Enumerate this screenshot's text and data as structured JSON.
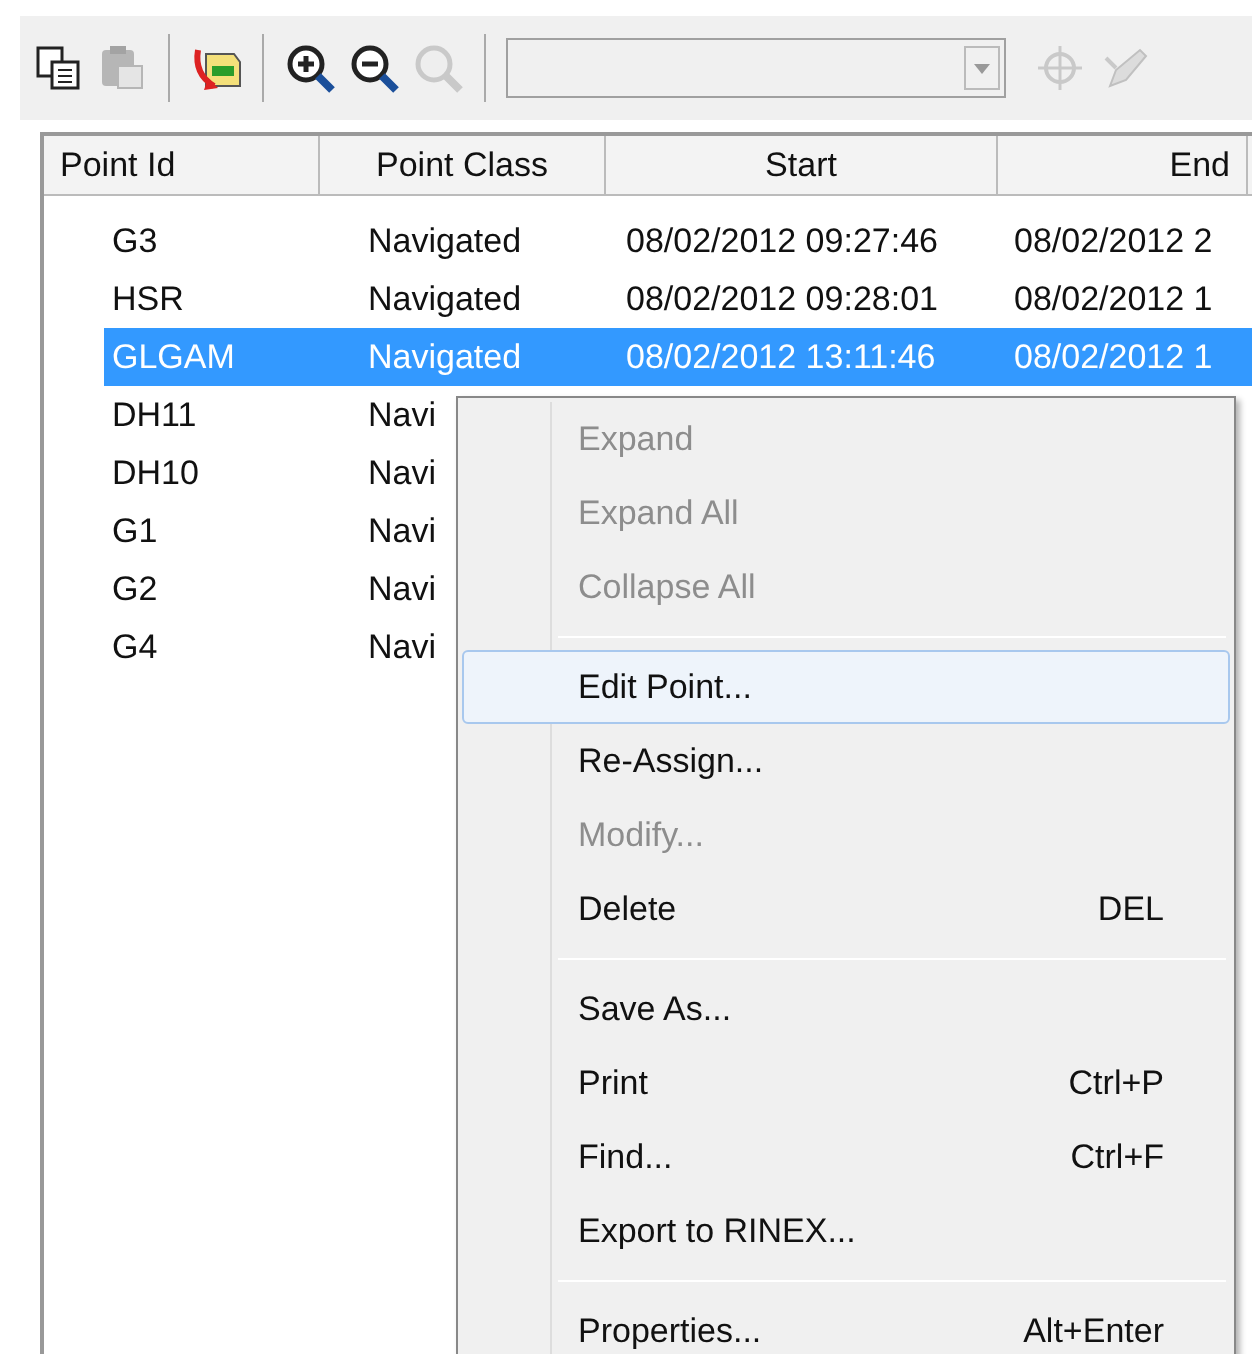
{
  "toolbar": {
    "groups": [
      [
        {
          "kind": "copy",
          "disabled": false
        },
        {
          "kind": "paste",
          "disabled": true
        }
      ],
      [
        {
          "kind": "transfer",
          "disabled": false
        }
      ],
      [
        {
          "kind": "zoom_in",
          "disabled": false
        },
        {
          "kind": "zoom_out",
          "disabled": false
        },
        {
          "kind": "zoom_reset",
          "disabled": true
        }
      ]
    ],
    "combo": {
      "disabled": true
    },
    "trailing": [
      {
        "kind": "target",
        "disabled": true
      },
      {
        "kind": "pen",
        "disabled": true
      }
    ]
  },
  "table": {
    "columns": [
      "Point Id",
      "Point Class",
      "Start",
      "End"
    ],
    "rows": [
      {
        "cells": [
          "G3",
          "Navigated",
          "08/02/2012 09:27:46",
          "08/02/2012 2"
        ],
        "selected": false
      },
      {
        "cells": [
          "HSR",
          "Navigated",
          "08/02/2012 09:28:01",
          "08/02/2012 1"
        ],
        "selected": false
      },
      {
        "cells": [
          "GLGAM",
          "Navigated",
          "08/02/2012 13:11:46",
          "08/02/2012 1"
        ],
        "selected": true
      },
      {
        "cells": [
          "DH11",
          "Navi"
        ],
        "selected": false
      },
      {
        "cells": [
          "DH10",
          "Navi"
        ],
        "selected": false
      },
      {
        "cells": [
          "G1",
          "Navi"
        ],
        "selected": false
      },
      {
        "cells": [
          "G2",
          "Navi"
        ],
        "selected": false
      },
      {
        "cells": [
          "G4",
          "Navi"
        ],
        "selected": false
      }
    ]
  },
  "context_menu": {
    "groups": [
      [
        {
          "label": "Expand",
          "disabled": true,
          "hovered": false
        },
        {
          "label": "Expand All",
          "disabled": true,
          "hovered": false
        },
        {
          "label": "Collapse All",
          "disabled": true,
          "hovered": false
        }
      ],
      [
        {
          "label": "Edit Point...",
          "disabled": false,
          "hovered": true
        },
        {
          "label": "Re-Assign...",
          "disabled": false,
          "hovered": false
        },
        {
          "label": "Modify...",
          "disabled": true,
          "hovered": false
        },
        {
          "label": "Delete",
          "shortcut": "DEL",
          "disabled": false,
          "hovered": false
        }
      ],
      [
        {
          "label": "Save As...",
          "disabled": false,
          "hovered": false
        },
        {
          "label": "Print",
          "shortcut": "Ctrl+P",
          "disabled": false,
          "hovered": false
        },
        {
          "label": "Find...",
          "shortcut": "Ctrl+F",
          "disabled": false,
          "hovered": false
        },
        {
          "label": "Export to RINEX...",
          "disabled": false,
          "hovered": false
        }
      ],
      [
        {
          "label": "Properties...",
          "shortcut": "Alt+Enter",
          "disabled": false,
          "hovered": false
        }
      ]
    ]
  }
}
